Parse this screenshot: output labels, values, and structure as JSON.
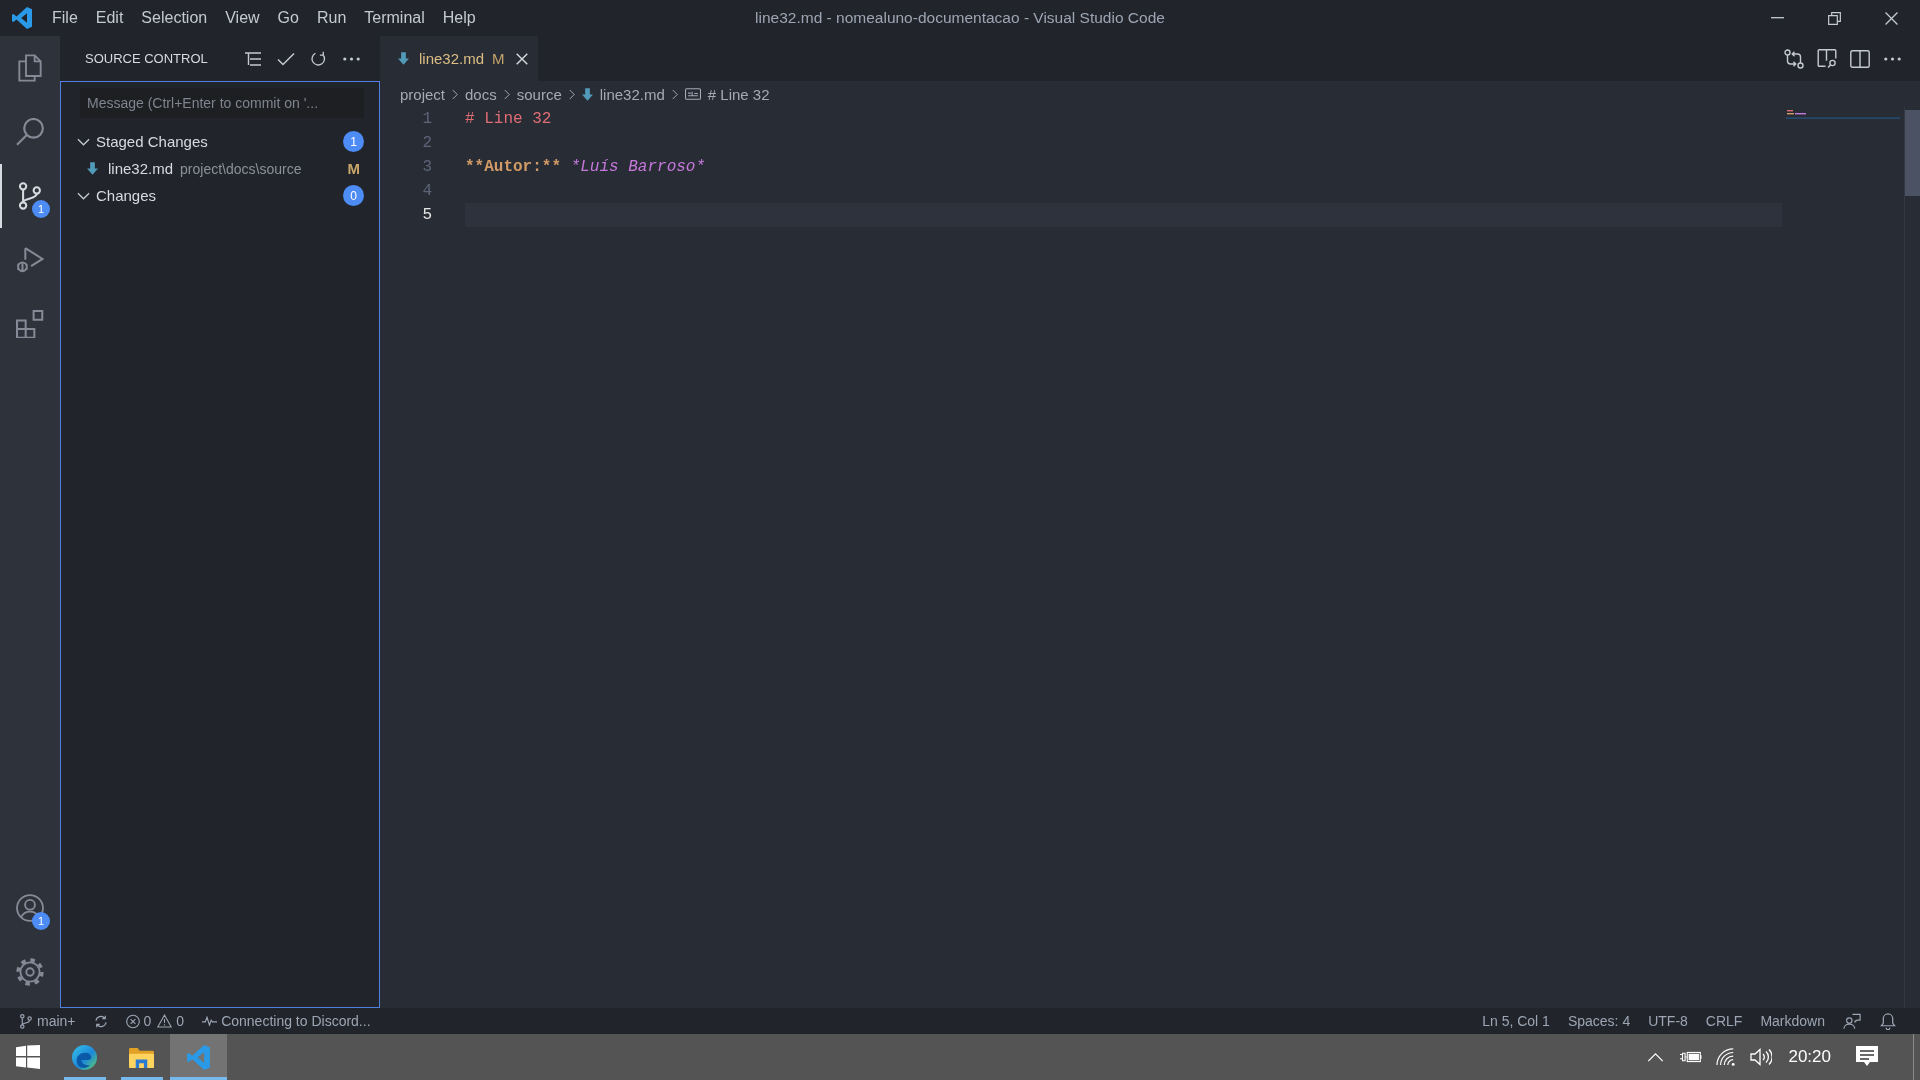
{
  "window": {
    "title": "line32.md - nomealuno-documentacao - Visual Studio Code"
  },
  "menu": [
    "File",
    "Edit",
    "Selection",
    "View",
    "Go",
    "Run",
    "Terminal",
    "Help"
  ],
  "activity_bar": {
    "items": [
      {
        "kind": "explorer",
        "selected": false
      },
      {
        "kind": "search",
        "selected": false
      },
      {
        "kind": "source_control",
        "selected": true,
        "badge": "1"
      },
      {
        "kind": "run",
        "selected": false
      },
      {
        "kind": "extensions",
        "selected": false
      }
    ],
    "bottom_items": [
      {
        "kind": "accounts",
        "badge": "1"
      },
      {
        "kind": "settings"
      }
    ]
  },
  "sidebar": {
    "title": "SOURCE CONTROL",
    "commit_message": {
      "placeholder": "Message (Ctrl+Enter to commit on '..."
    },
    "groups": [
      {
        "label": "Staged Changes",
        "count": "1",
        "expanded": true,
        "files": [
          {
            "name": "line32.md",
            "path": "project\\docs\\source",
            "status": "M"
          }
        ]
      },
      {
        "label": "Changes",
        "count": "0",
        "expanded": true
      }
    ]
  },
  "editor": {
    "tabs": [
      {
        "label": "line32.md",
        "status": "M",
        "selected": true
      }
    ],
    "breadcrumbs": [
      {
        "kind": "folder",
        "label": "project"
      },
      {
        "kind": "folder",
        "label": "docs"
      },
      {
        "kind": "folder",
        "label": "source"
      },
      {
        "kind": "file",
        "label": "line32.md"
      },
      {
        "kind": "symbol",
        "label": "# Line 32"
      }
    ],
    "lines": [
      {
        "number": "1",
        "current": false,
        "tokens": [
          {
            "kind": "heading",
            "text": "# Line 32"
          }
        ]
      },
      {
        "number": "2",
        "current": false
      },
      {
        "number": "3",
        "current": false,
        "tokens": [
          {
            "kind": "bold",
            "text": "**Autor:**"
          },
          {
            "kind": "italic",
            "text": "*Luís Barroso*"
          }
        ]
      },
      {
        "number": "4",
        "current": false
      },
      {
        "number": "5",
        "current": true
      }
    ]
  },
  "status_bar": {
    "left": [
      {
        "kind": "branch",
        "text": "main+"
      },
      {
        "kind": "sync"
      },
      {
        "kind": "problems",
        "errors": "0",
        "warnings": "0"
      },
      {
        "kind": "activity",
        "text": "Connecting to Discord..."
      }
    ],
    "right": [
      {
        "kind": "text",
        "text": "Ln 5, Col 1"
      },
      {
        "kind": "text",
        "text": "Spaces: 4"
      },
      {
        "kind": "text",
        "text": "UTF-8"
      },
      {
        "kind": "text",
        "text": "CRLF"
      },
      {
        "kind": "text",
        "text": "Markdown"
      },
      {
        "kind": "feedback"
      },
      {
        "kind": "notifications"
      }
    ]
  },
  "taskbar": {
    "apps": [
      {
        "kind": "browser",
        "running": true,
        "selected": false
      },
      {
        "kind": "files",
        "running": true,
        "selected": false
      },
      {
        "kind": "code_editor",
        "running": true,
        "selected": true
      }
    ],
    "clock": "20:20"
  }
}
